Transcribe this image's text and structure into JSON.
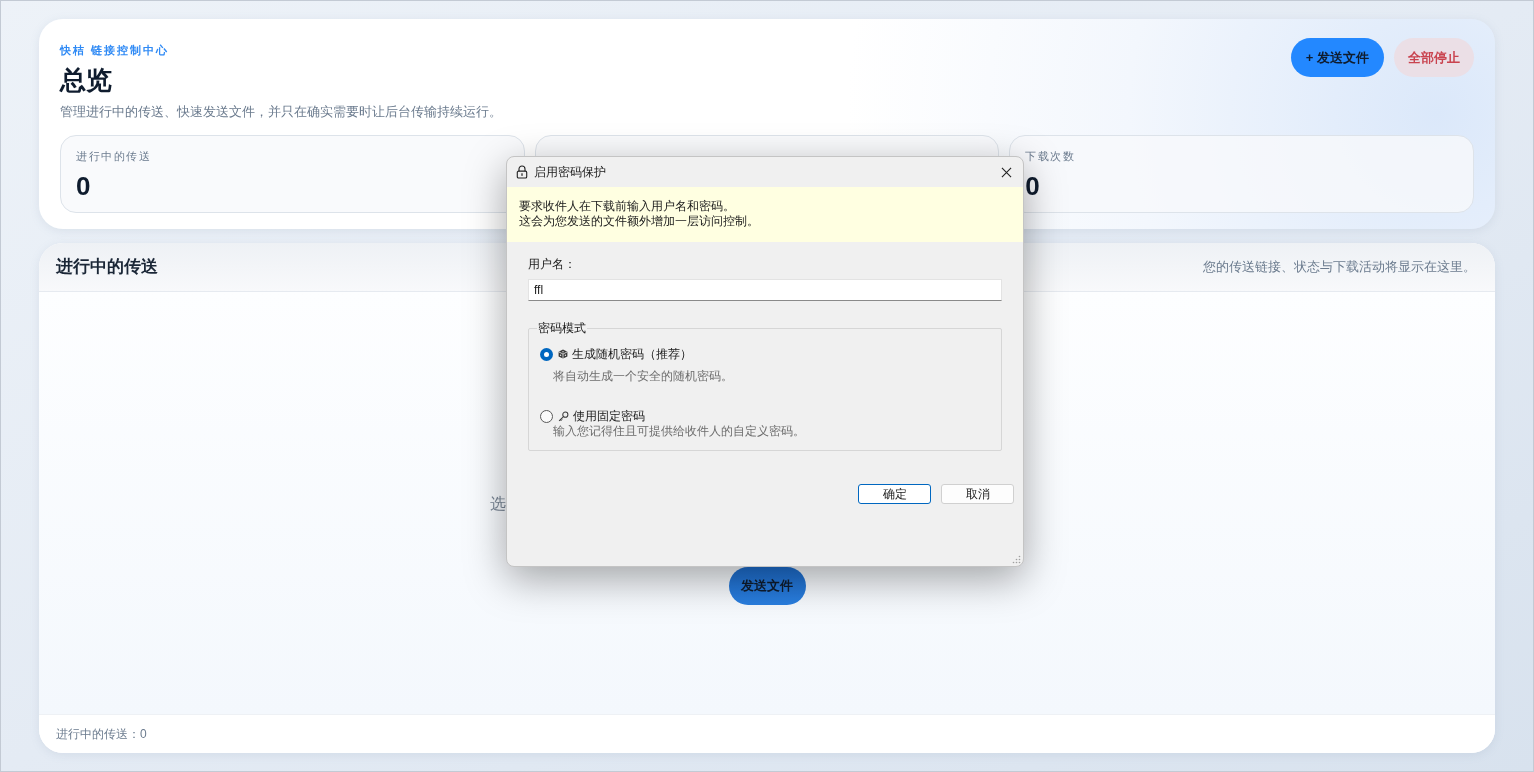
{
  "header": {
    "eyebrow": "快桔 链接控制中心",
    "title": "总览",
    "description": "管理进行中的传送、快速发送文件，并只在确实需要时让后台传输持续运行。"
  },
  "actions": [
    {
      "kind": "primary",
      "label": "+ 发送文件"
    },
    {
      "kind": "danger",
      "label": "全部停止"
    }
  ],
  "stats": [
    {
      "kind": "counter",
      "label": "进行中的传送",
      "value": "0"
    },
    {
      "kind": "covered"
    },
    {
      "kind": "counter",
      "label": "下载次数",
      "value": "0"
    }
  ],
  "transfers_panel": {
    "title": "进行中的传送",
    "hint": "您的传送链接、状态与下载活动将显示在这里。",
    "empty_state": {
      "message": "选",
      "button": "发送文件"
    },
    "status_bar": "进行中的传送：0"
  },
  "dialog": {
    "title": "启用密码保护",
    "notice": [
      "要求收件人在下载前输入用户名和密码。",
      "这会为您发送的文件额外增加一层访问控制。"
    ],
    "username": {
      "label": "用户名：",
      "value": "ffl"
    },
    "password_mode": {
      "legend": "密码模式",
      "options": [
        {
          "kind": "random",
          "label": "生成随机密码（推荐）",
          "description": "将自动生成一个安全的随机密码。",
          "selected": true
        },
        {
          "kind": "fixed",
          "label": "使用固定密码",
          "description": "输入您记得住且可提供给收件人的自定义密码。",
          "selected": false
        }
      ]
    },
    "buttons": [
      {
        "label": "确定",
        "default": true
      },
      {
        "label": "取消",
        "default": false
      }
    ]
  }
}
